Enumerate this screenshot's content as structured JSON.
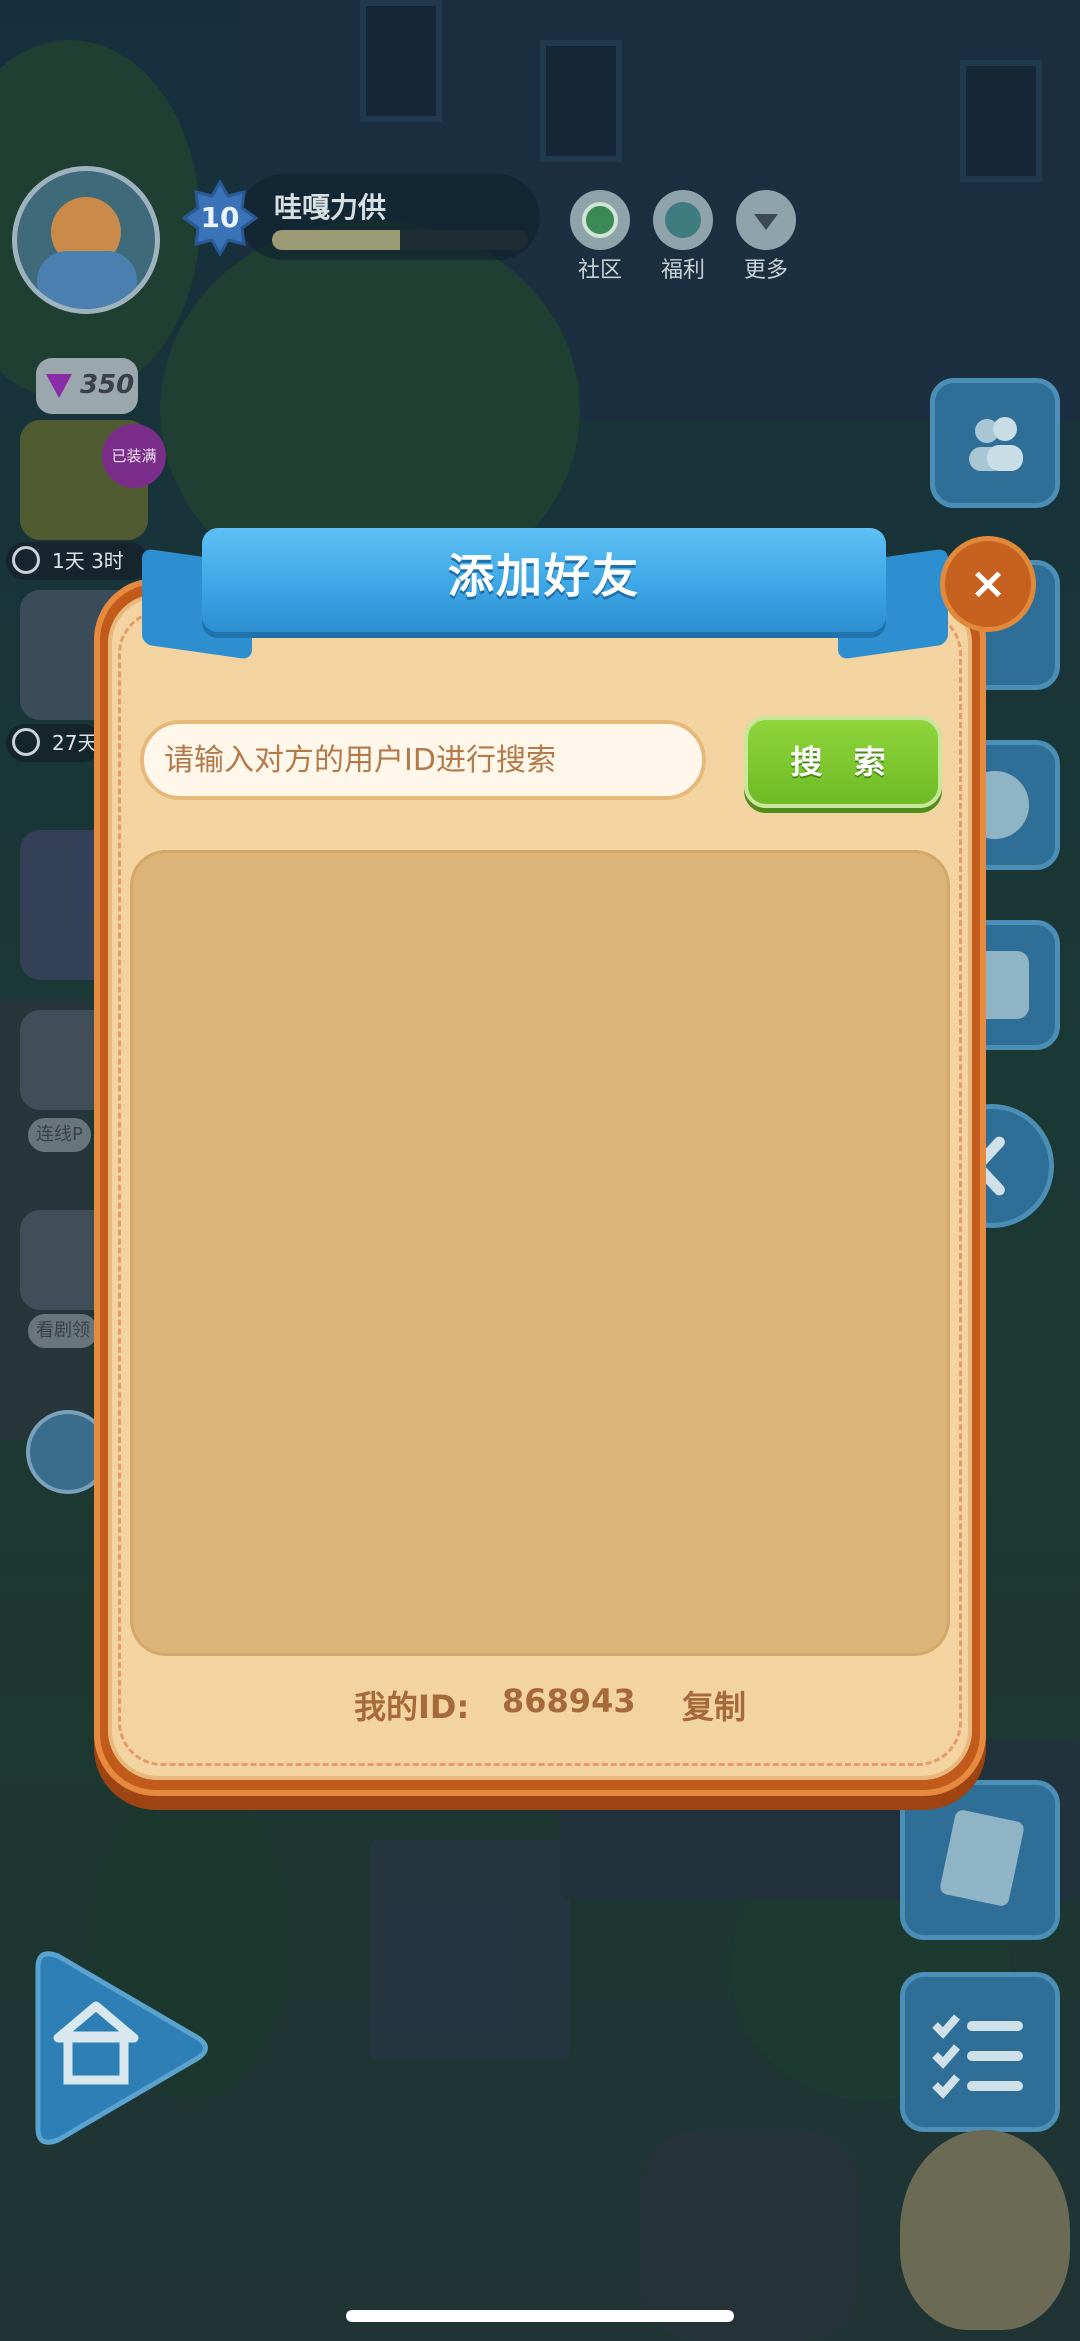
{
  "hud": {
    "player_name": "哇嘎力供",
    "level": "10",
    "xp_progress": 0.5,
    "community_label": "社区",
    "welfare_label": "福利",
    "more_label": "更多",
    "gems": "350",
    "badge_full": "已装满",
    "timer_1": "1天 3时",
    "timer_2": "27天",
    "left_label_1": "连线P",
    "left_label_2": "看剧领"
  },
  "dialog": {
    "title": "添加好友",
    "close_symbol": "×",
    "search_placeholder": "请输入对方的用户ID进行搜索",
    "search_value": "",
    "search_button": "搜 索",
    "my_id_label": "我的ID:",
    "my_id_value": "868943",
    "copy_label": "复制"
  },
  "colors": {
    "ribbon": "#3ba4e4",
    "frame": "#c25a1c",
    "panel": "#f3d4a1",
    "search_button": "#6ebb26",
    "text_brown": "#a5693a"
  },
  "icons": [
    "friends-icon",
    "close-icon",
    "film-icon",
    "photo-icon",
    "collapse-icon",
    "book-icon",
    "checklist-icon",
    "home-icon",
    "gem-icon",
    "clock-icon"
  ]
}
